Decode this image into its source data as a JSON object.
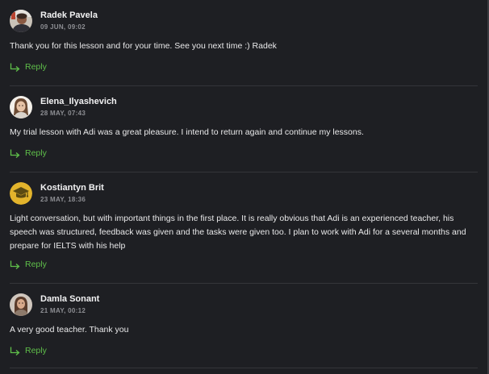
{
  "comments": [
    {
      "author": "Radek Pavela",
      "date": "09 JUN, 09:02",
      "text": "Thank you for this lesson and for your time. See you next time :) Radek",
      "reply_label": "Reply",
      "avatar_icon": "user-photo-avatar"
    },
    {
      "author": "Elena_Ilyashevich",
      "date": "28 MAY, 07:43",
      "text": "My trial lesson with Adi was a great pleasure. I intend to return again and continue my lessons.",
      "reply_label": "Reply",
      "avatar_icon": "user-photo-avatar"
    },
    {
      "author": "Kostiantyn Brit",
      "date": "23 MAY, 18:36",
      "text": "Light conversation, but with important things in the first place. It is really obvious that Adi is an experienced teacher, his speech was structured, feedback was given and the tasks were given too. I plan to work with Adi for a several months and prepare for IELTS with his help",
      "reply_label": "Reply",
      "avatar_icon": "graduation-cap-avatar"
    },
    {
      "author": "Damla Sonant",
      "date": "21 MAY, 00:12",
      "text": "A very good teacher. Thank you",
      "reply_label": "Reply",
      "avatar_icon": "user-photo-avatar"
    }
  ],
  "colors": {
    "background": "#1e1f23",
    "reply_accent": "#5fbf4a",
    "divider": "#34353a",
    "date_text": "#8e8f94"
  }
}
